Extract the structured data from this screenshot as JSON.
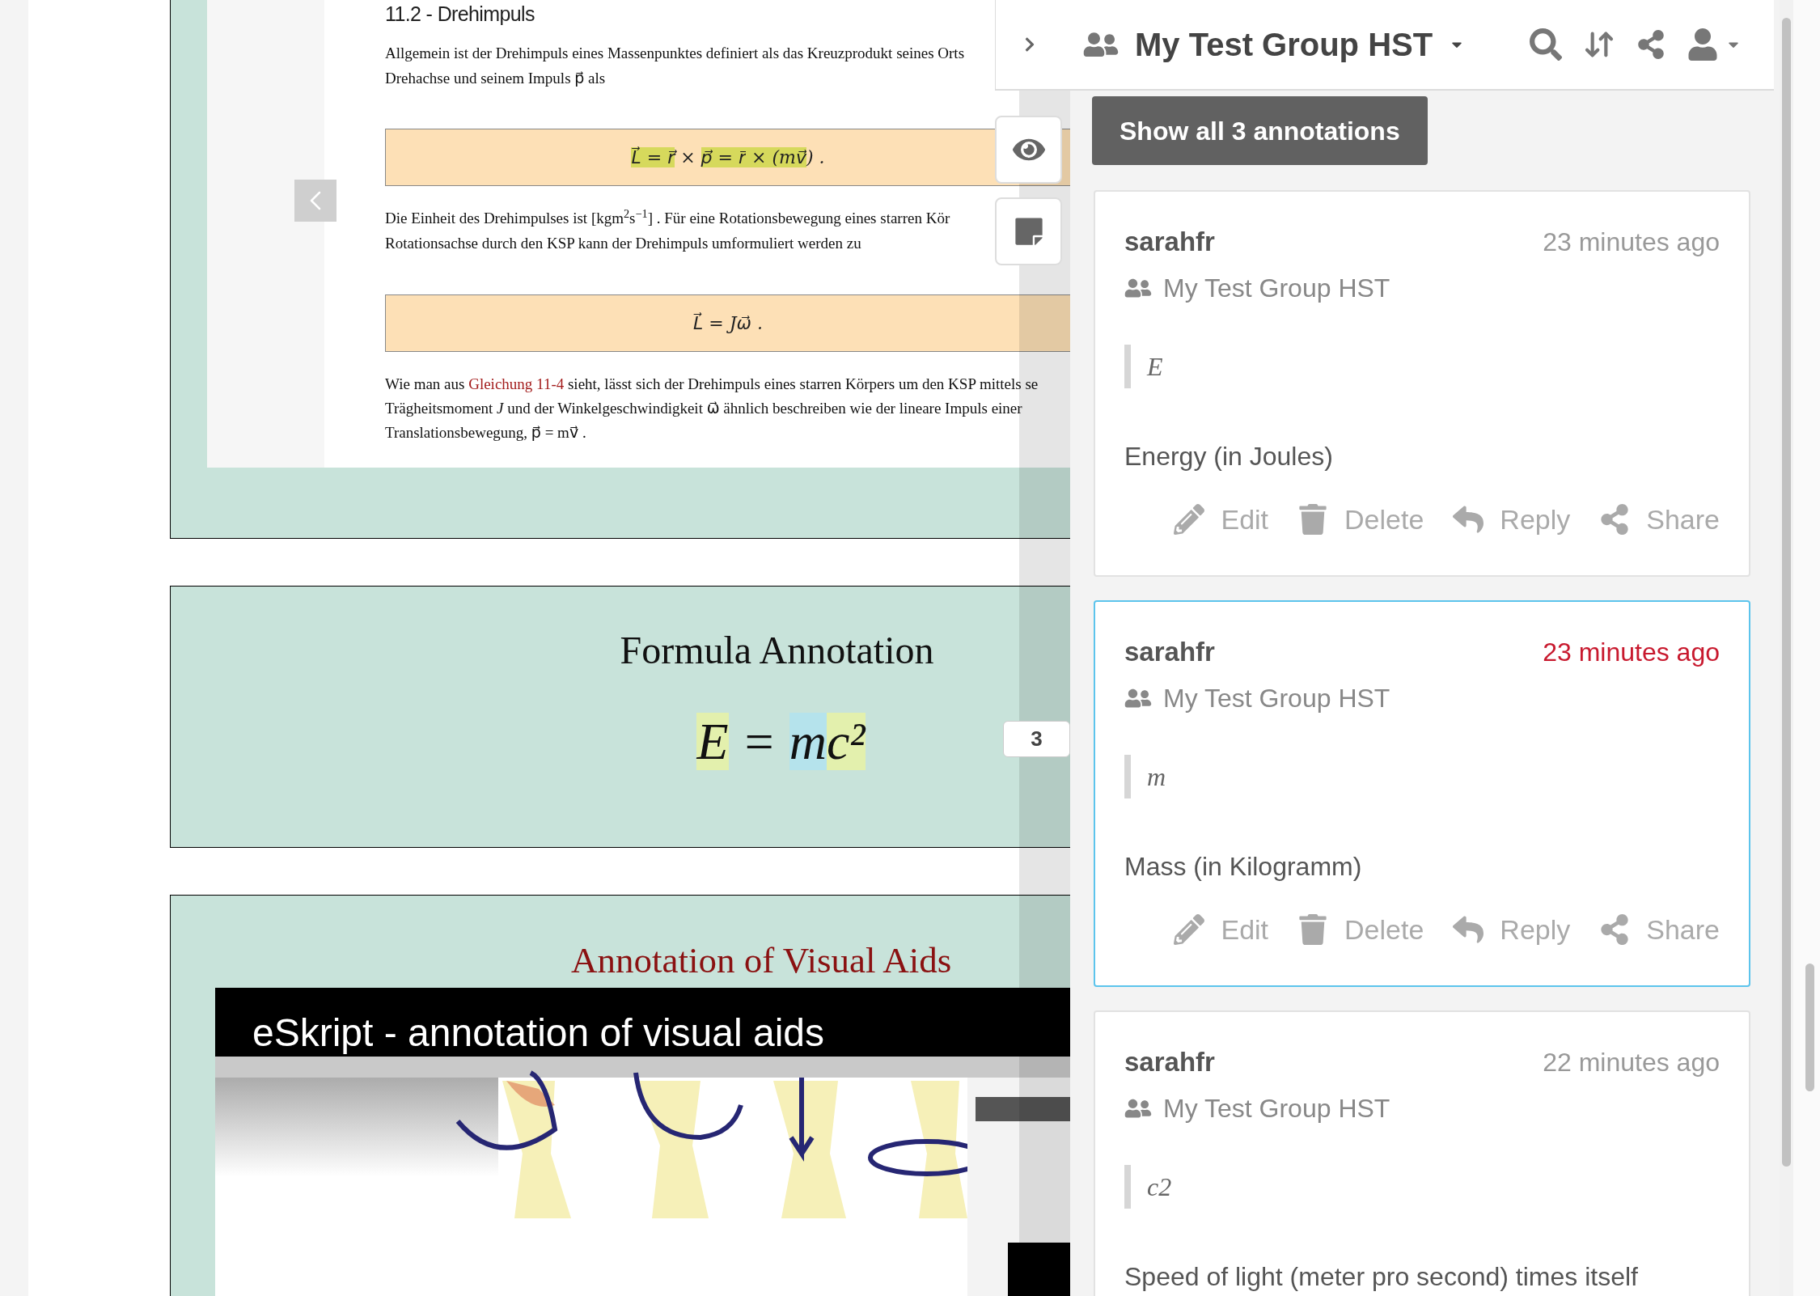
{
  "document": {
    "heading": "11.2 - Drehimpuls",
    "paragraph_1": [
      "Allgemein ist der Drehimpuls eines Massenpunktes definiert als das Kreuzprodukt seines Orts",
      "Drehachse und seinem Impuls p⃗ als"
    ],
    "formula_1": [
      {
        "text": "L⃗",
        "color": "#d6d95c"
      },
      {
        "text": " = ",
        "color": "#d6d95c"
      },
      {
        "text": "r⃗",
        "color": "#d6d95c"
      },
      {
        "text": " × "
      },
      {
        "text": "p⃗",
        "color": "#d6d95c"
      },
      {
        "text": " = ",
        "color": "#d6d95c"
      },
      {
        "text": "r⃗",
        "color": "#d6d95c"
      },
      {
        "text": " × ",
        "color": "#d6d95c"
      },
      {
        "text": "(mv⃗",
        "color": "#d6d95c"
      },
      {
        "text": ")"
      },
      {
        "text": " ."
      }
    ],
    "paragraph_2": [
      "Die Einheit des Drehimpulses ist [kgm$^{2}$s$^{−1}$] . Für eine Rotationsbewegung eines starren Kör",
      "Rotationsachse durch den KSP kann der Drehimpuls umformuliert werden zu"
    ],
    "formula_2": [
      {
        "text": "L⃗ = Jω⃗ ."
      }
    ],
    "paragraph_3": {
      "lead": "Wie man aus ",
      "link": "Gleichung 11-4",
      "lines": [
        " sieht, lässt sich der Drehimpuls eines starren Körpers um den KSP mittels se",
        "Trägheitsmoment *J* und der Winkelgeschwindigkeit ω⃗ ähnlich beschreiben wie der lineare Impuls einer",
        "Translationsbewegung, p⃗ = mv⃗ ."
      ]
    }
  },
  "formula_slide": {
    "title": "Formula Annotation",
    "formula": [
      {
        "text": "E",
        "color": "#e3f0ad"
      },
      {
        "text": " = "
      },
      {
        "text": "m",
        "color": "#b5e3ec"
      },
      {
        "text": "c²",
        "color": "#e3f0ad"
      }
    ],
    "annotation_count": "3"
  },
  "visual_aids_slide": {
    "title": "Annotation of Visual Aids",
    "video": {
      "title": "eSkript - annotation of visual aids"
    }
  },
  "sidebar": {
    "header": {
      "group": "My Test Group HST"
    },
    "show_all_button": "Show all 3 annotations",
    "annotations": [
      {
        "user": "sarahfr",
        "time": "23 minutes ago",
        "group": "My Test Group HST",
        "quote": "E",
        "body": "Energy (in Joules)",
        "selected": false,
        "actions": [
          {
            "kind": "edit",
            "label": "Edit"
          },
          {
            "kind": "delete",
            "label": "Delete"
          },
          {
            "kind": "reply",
            "label": "Reply"
          },
          {
            "kind": "share",
            "label": "Share"
          }
        ]
      },
      {
        "user": "sarahfr",
        "time": "23 minutes ago",
        "group": "My Test Group HST",
        "quote": "m",
        "body": "Mass (in Kilogramm)",
        "selected": true,
        "actions": [
          {
            "kind": "edit",
            "label": "Edit"
          },
          {
            "kind": "delete",
            "label": "Delete"
          },
          {
            "kind": "reply",
            "label": "Reply"
          },
          {
            "kind": "share",
            "label": "Share"
          }
        ]
      },
      {
        "user": "sarahfr",
        "time": "22 minutes ago",
        "group": "My Test Group HST",
        "quote": "c2",
        "body": "Speed of light (meter pro second) times itself",
        "selected": false
      }
    ]
  }
}
